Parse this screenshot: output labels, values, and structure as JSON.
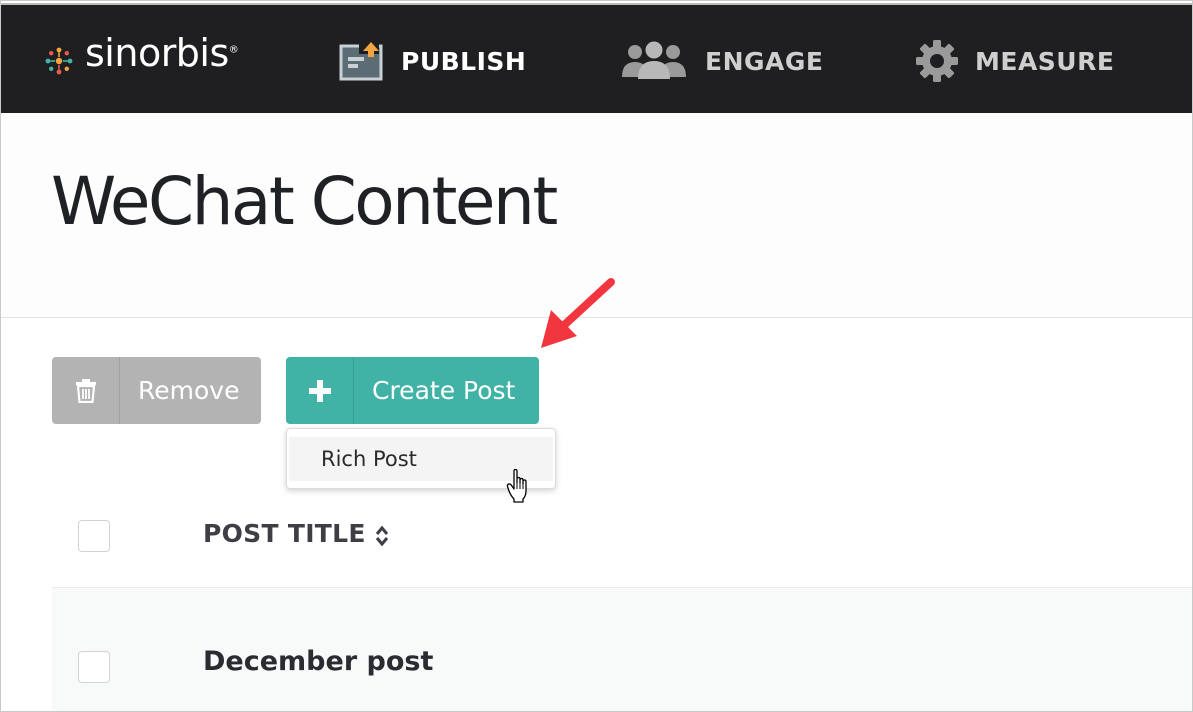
{
  "app": {
    "logo_text": "sinorbis",
    "logo_reg": "®"
  },
  "nav": {
    "items": [
      {
        "label": "PUBLISH",
        "icon": "publish-icon",
        "active": true
      },
      {
        "label": "ENGAGE",
        "icon": "users-icon",
        "active": false
      },
      {
        "label": "MEASURE",
        "icon": "gear-icon",
        "active": false
      }
    ]
  },
  "page": {
    "title": "WeChat Content"
  },
  "toolbar": {
    "remove_label": "Remove",
    "create_label": "Create Post"
  },
  "dropdown": {
    "items": [
      {
        "label": "Rich Post"
      }
    ]
  },
  "table": {
    "columns": [
      {
        "label": "POST TITLE",
        "sortable": true
      }
    ],
    "rows": [
      {
        "title": "December post"
      }
    ]
  },
  "colors": {
    "nav_bg": "#1f1f21",
    "accent_teal": "#41b3a6",
    "remove_gray": "#b3b3b3",
    "annotation_red": "#f2363f"
  }
}
